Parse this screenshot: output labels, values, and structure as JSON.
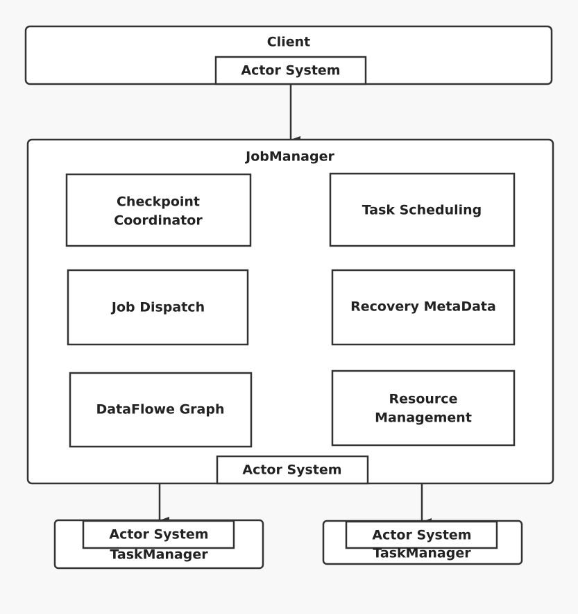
{
  "client": {
    "title": "Client",
    "actor_system": "Actor System"
  },
  "job_manager": {
    "title": "JobManager",
    "components": [
      [
        "Checkpoint",
        "Coordinator"
      ],
      [
        "Task Scheduling"
      ],
      [
        "Job Dispatch"
      ],
      [
        "Recovery MetaData"
      ],
      [
        "DataFlowe Graph"
      ],
      [
        "Resource",
        "Management"
      ]
    ],
    "actor_system": "Actor System"
  },
  "task_managers": [
    {
      "title": "TaskManager",
      "actor_system": "Actor System"
    },
    {
      "title": "TaskManager",
      "actor_system": "Actor System"
    }
  ],
  "colors": {
    "background": "#f8f8f8",
    "stroke": "#333333",
    "fill": "#ffffff"
  }
}
